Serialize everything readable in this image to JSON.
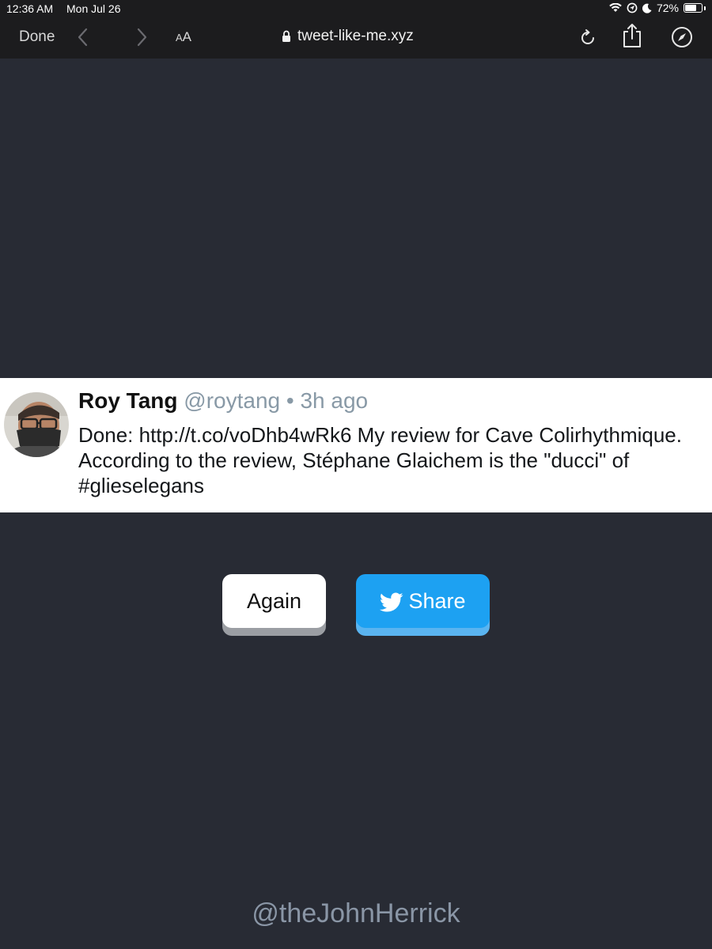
{
  "status_bar": {
    "time": "12:36 AM",
    "date": "Mon Jul 26",
    "battery": "72%",
    "battery_level": 0.72
  },
  "browser": {
    "done_label": "Done",
    "text_size_small": "A",
    "text_size_large": "A",
    "url": "tweet-like-me.xyz"
  },
  "tweet": {
    "name": "Roy Tang",
    "handle": "@roytang",
    "separator": "•",
    "time": "3h ago",
    "text": "Done: http://t.co/voDhb4wRk6 My review for Cave Colirhythmique. According to the review, Stéphane Glaichem is the \"ducci\" of #glieselegans"
  },
  "actions": {
    "again_label": "Again",
    "share_label": "Share"
  },
  "footer": {
    "credit": "@theJohnHerrick"
  },
  "colors": {
    "page_background": "#282b34",
    "twitter_blue": "#1da1f2",
    "muted_text": "#8899a6"
  },
  "icons": [
    "back-icon",
    "forward-icon",
    "lock-icon",
    "reload-icon",
    "share-icon",
    "compass-icon",
    "wifi-icon",
    "location-icon",
    "moon-icon",
    "battery-icon",
    "twitter-bird-icon"
  ]
}
